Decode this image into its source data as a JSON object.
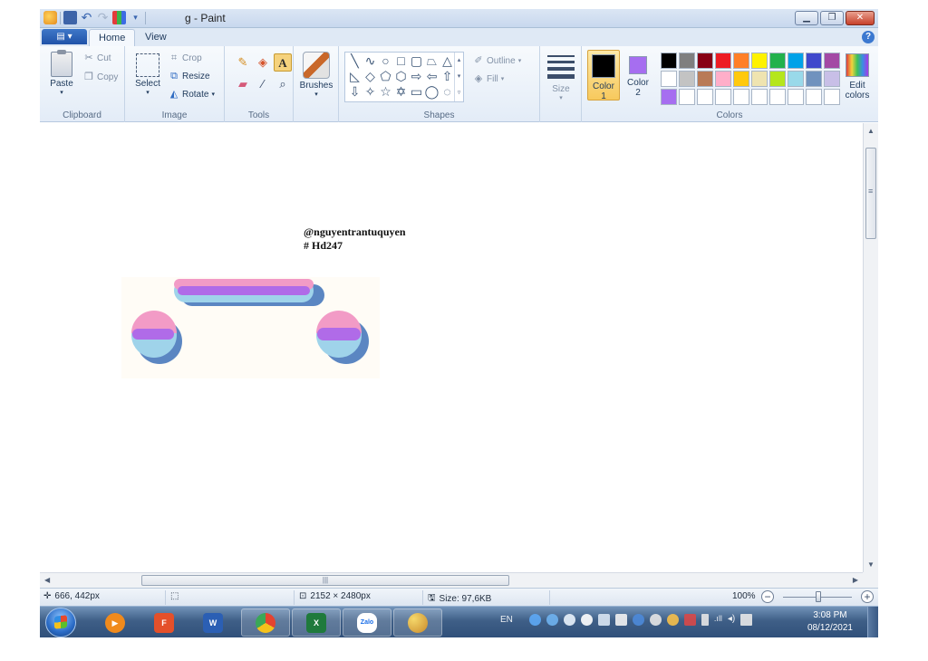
{
  "window": {
    "title": "g - Paint"
  },
  "tabs": {
    "file": "▤ ▾",
    "home": "Home",
    "view": "View"
  },
  "clipboard": {
    "label": "Clipboard",
    "paste": "Paste",
    "cut": "Cut",
    "copy": "Copy"
  },
  "image": {
    "label": "Image",
    "select": "Select",
    "crop": "Crop",
    "resize": "Resize",
    "rotate": "Rotate"
  },
  "tools": {
    "label": "Tools",
    "text_tool": "A"
  },
  "brushes": {
    "label": "Brushes"
  },
  "shapes": {
    "label": "Shapes",
    "outline": "Outline",
    "fill": "Fill"
  },
  "size": {
    "label": "Size"
  },
  "colors": {
    "label": "Colors",
    "color1_label": "Color",
    "color1_num": "1",
    "color2_label": "Color",
    "color2_num": "2",
    "edit_label": "Edit",
    "edit_label2": "colors",
    "color1_value": "#000000",
    "color2_value": "#a66ef0",
    "palette": [
      "#000000",
      "#7f7f7f",
      "#880015",
      "#ed1c24",
      "#ff7f27",
      "#fff200",
      "#22b14c",
      "#00a2e8",
      "#3f48cc",
      "#a349a4",
      "#ffffff",
      "#c3c3c3",
      "#b97a57",
      "#ffaec9",
      "#ffc90e",
      "#efe4b0",
      "#b5e61d",
      "#99d9ea",
      "#7092be",
      "#c8bfe7",
      "#a66ef0",
      "#ffffff",
      "#ffffff",
      "#ffffff",
      "#ffffff",
      "#ffffff",
      "#ffffff",
      "#ffffff",
      "#ffffff",
      "#ffffff"
    ]
  },
  "canvas": {
    "watermark_line1": "@nguyentrantuquyen",
    "watermark_line2": "# Hd247"
  },
  "status": {
    "cursor_pos": "666, 442px",
    "image_size": "2152 × 2480px",
    "file_size": "Size: 97,6KB",
    "zoom": "100%"
  },
  "taskbar": {
    "lang": "EN",
    "time": "3:08 PM",
    "date": "08/12/2021",
    "apps": [
      "media-player",
      "foxit-reader",
      "word",
      "chrome",
      "excel",
      "zalo",
      "paint"
    ],
    "zalo_label": "Zalo"
  }
}
